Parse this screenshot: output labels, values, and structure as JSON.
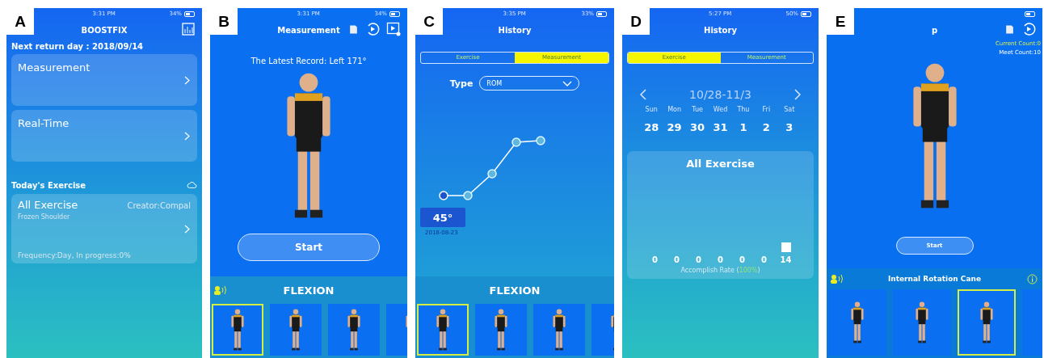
{
  "panels": [
    {
      "label": "A",
      "kind": "home",
      "status": {
        "time": "3:31 PM",
        "battery": "34%"
      },
      "title": "BOOSTFIX",
      "next_return": "Next return day : 2018/09/14",
      "cards": [
        {
          "title": "Measurement"
        },
        {
          "title": "Real-Time"
        }
      ],
      "section_title": "Today's Exercise",
      "exercise": {
        "title": "All Exercise",
        "creator": "Creator:Compal",
        "subtitle": "Frozen Shoulder",
        "footer": "Frequency:Day, In progress:0%"
      }
    },
    {
      "label": "B",
      "kind": "measurement",
      "status": {
        "time": "3:31 PM",
        "battery": "34%"
      },
      "title": "Measurement",
      "record": "The Latest Record: Left 171°",
      "button": "Start",
      "exercise_name": "FLEXION",
      "thumbnails": [
        {
          "selected": true
        },
        {
          "selected": false
        },
        {
          "selected": false
        },
        {
          "selected": false
        }
      ]
    },
    {
      "label": "C",
      "kind": "history_chart",
      "status": {
        "time": "3:35 PM",
        "battery": "33%"
      },
      "title": "History",
      "tabs": [
        {
          "label": "Exercise",
          "selected": false
        },
        {
          "label": "Measurement",
          "selected": true
        }
      ],
      "type_label": "Type",
      "type_value": "ROM",
      "point_value": "45°",
      "point_date": "2018-08-23",
      "exercise_name": "FLEXION",
      "thumbnails": [
        {
          "selected": true
        },
        {
          "selected": false
        },
        {
          "selected": false
        },
        {
          "selected": false
        }
      ]
    },
    {
      "label": "D",
      "kind": "history_calendar",
      "status": {
        "time": "5:27 PM",
        "battery": "50%"
      },
      "title": "History",
      "tabs": [
        {
          "label": "Exercise",
          "selected": true
        },
        {
          "label": "Measurement",
          "selected": false
        }
      ],
      "date_range": "10/28-11/3",
      "weekdays": [
        "Sun",
        "Mon",
        "Tue",
        "Wed",
        "Thu",
        "Fri",
        "Sat"
      ],
      "dates": [
        "28",
        "29",
        "30",
        "31",
        "1",
        "2",
        "3"
      ],
      "summary": {
        "title": "All Exercise",
        "counts": [
          "0",
          "0",
          "0",
          "0",
          "0",
          "0",
          "14"
        ],
        "rate_label": "Accomplish Rate (",
        "rate_value": "100%",
        "rate_close": ")"
      }
    },
    {
      "label": "E",
      "kind": "exercise",
      "title": "p",
      "current_count": "Current Count:0",
      "meet_count": "Meet Count:10",
      "button": "Start",
      "exercise_name": "Internal Rotation Cane",
      "thumbnails": [
        {
          "selected": false
        },
        {
          "selected": false
        },
        {
          "selected": true
        },
        {
          "selected": false
        }
      ]
    }
  ]
}
